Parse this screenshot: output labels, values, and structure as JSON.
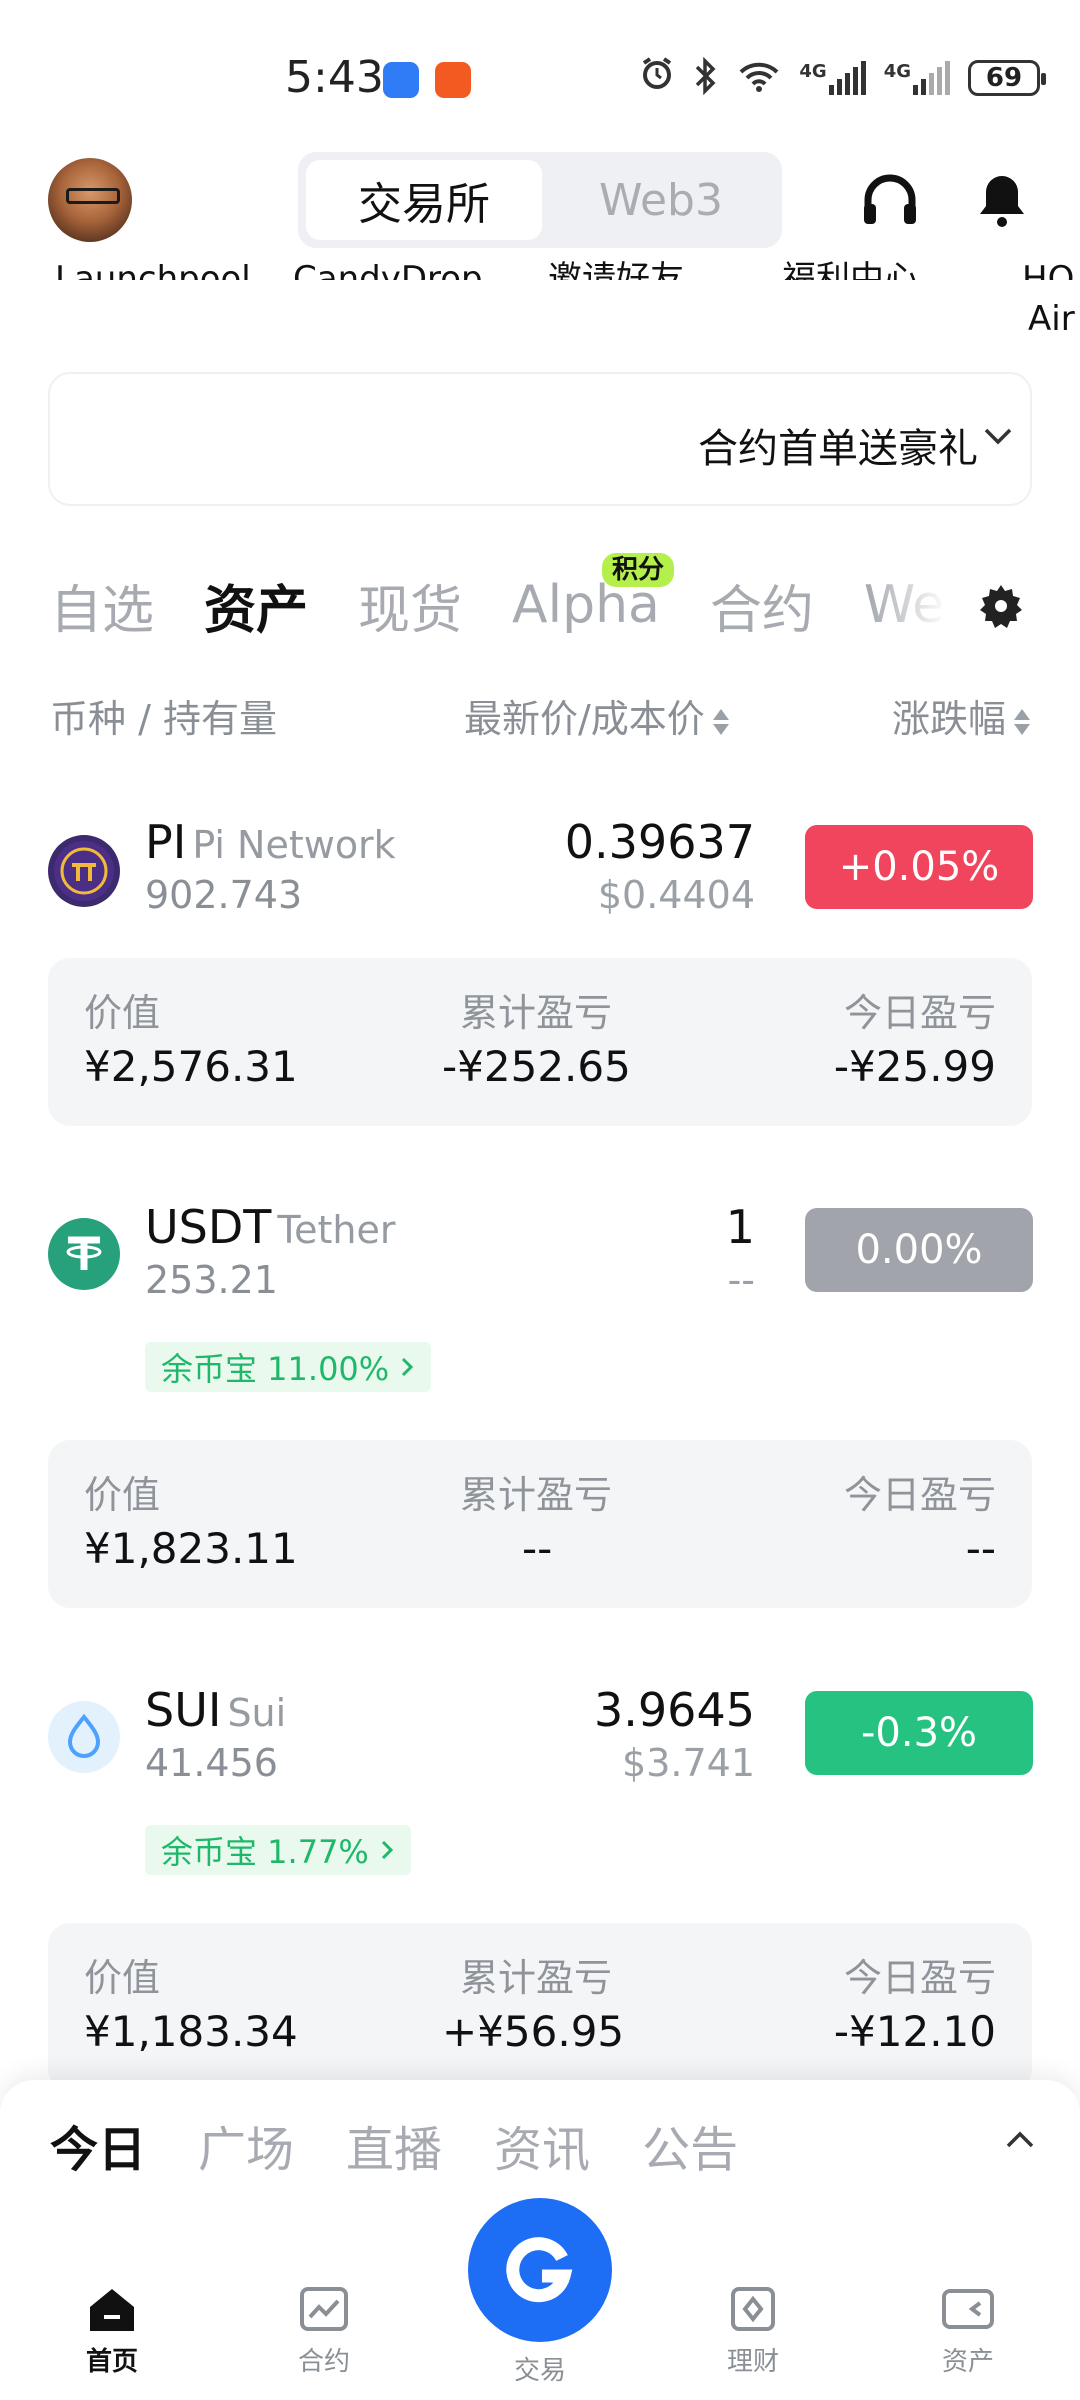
{
  "status_bar": {
    "time": "5:43",
    "network1": "4G",
    "network2": "4G",
    "battery": "69"
  },
  "header": {
    "segment_exchange": "交易所",
    "segment_web3": "Web3"
  },
  "shortcuts": [
    "Launchpool",
    "CandyDrop",
    "邀请好友",
    "福利中心",
    "HO",
    "Air"
  ],
  "banner": {
    "text": "合约首单送豪礼"
  },
  "tabs": {
    "items": [
      "自选",
      "资产",
      "现货",
      "Alpha",
      "合约",
      "We"
    ],
    "active": "资产",
    "badge": "积分"
  },
  "columns": {
    "coin": "币种 / 持有量",
    "price": "最新价/成本价",
    "change": "涨跌幅"
  },
  "assets": [
    {
      "symbol": "PI",
      "name": "Pi Network",
      "holding": "902.743",
      "price": "0.39637",
      "cost": "$0.4404",
      "change": "+0.05%",
      "change_color": "#f0455c",
      "value_label": "价值",
      "value": "¥2,576.31",
      "total_pnl_label": "累计盈亏",
      "total_pnl": "-¥252.65",
      "today_pnl_label": "今日盈亏",
      "today_pnl": "-¥25.99"
    },
    {
      "symbol": "USDT",
      "name": "Tether",
      "holding": "253.21",
      "price": "1",
      "cost": "--",
      "change": "0.00%",
      "change_color": "#a1a4aa",
      "earn": "余币宝 11.00%",
      "value_label": "价值",
      "value": "¥1,823.11",
      "total_pnl_label": "累计盈亏",
      "total_pnl": "--",
      "today_pnl_label": "今日盈亏",
      "today_pnl": "--"
    },
    {
      "symbol": "SUI",
      "name": "Sui",
      "holding": "41.456",
      "price": "3.9645",
      "cost": "$3.741",
      "change": "-0.3%",
      "change_color": "#26c281",
      "earn": "余币宝 1.77%",
      "value_label": "价值",
      "value": "¥1,183.34",
      "total_pnl_label": "累计盈亏",
      "total_pnl": "+¥56.95",
      "today_pnl_label": "今日盈亏",
      "today_pnl": "-¥12.10"
    }
  ],
  "news_tabs": [
    "今日",
    "广场",
    "直播",
    "资讯",
    "公告"
  ],
  "bottom_nav": {
    "home": "首页",
    "futures": "合约",
    "trade": "交易",
    "finance": "理财",
    "assets": "资产"
  }
}
